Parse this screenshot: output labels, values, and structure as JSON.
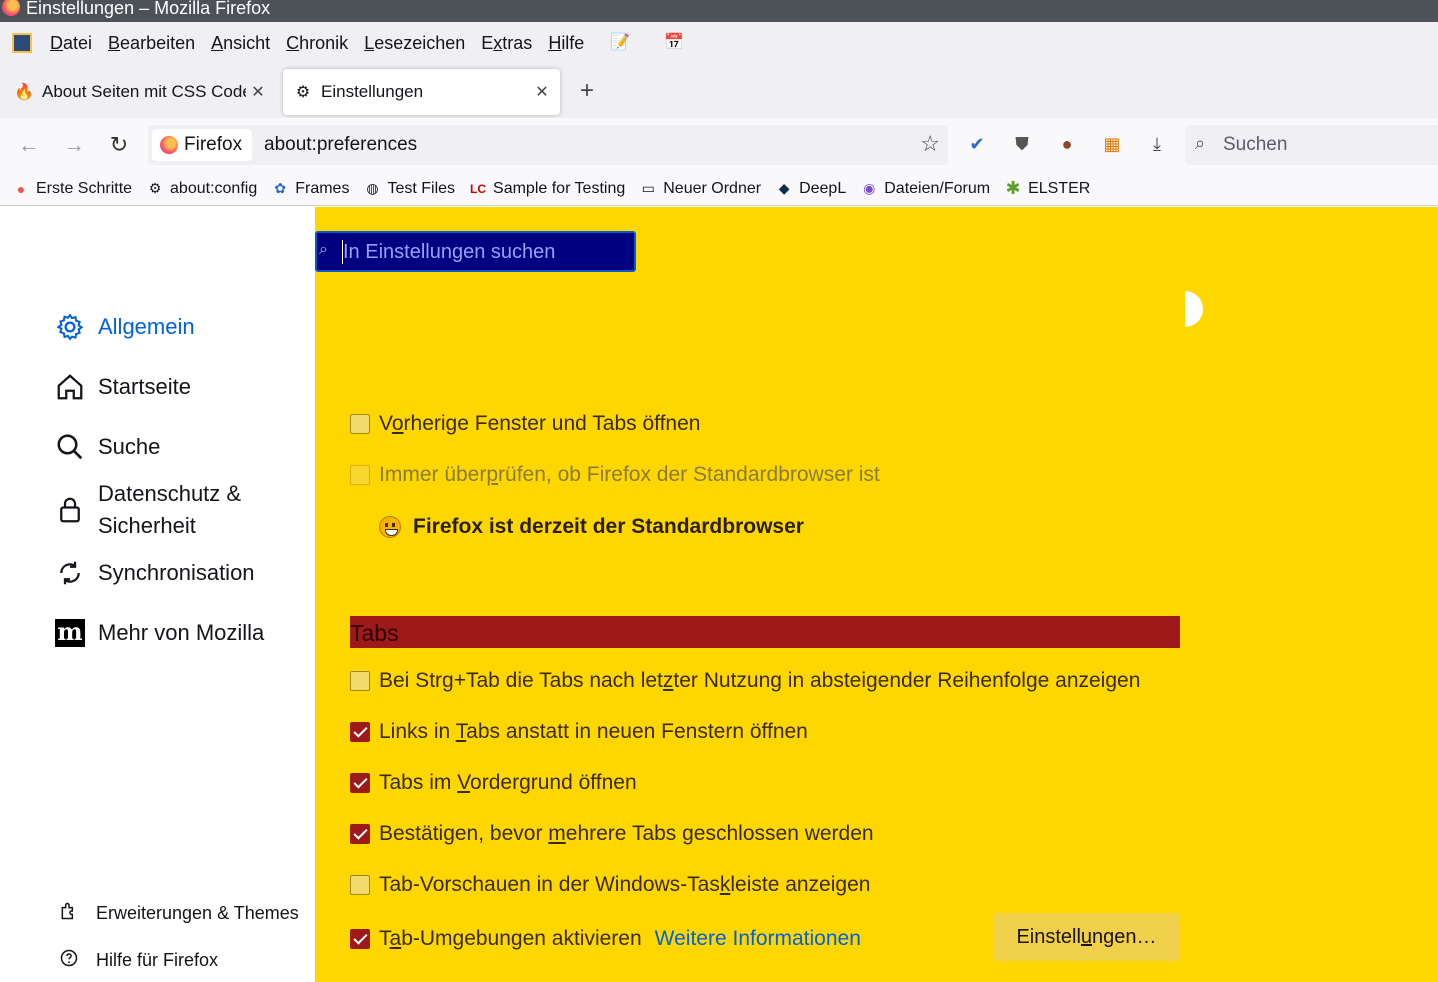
{
  "window": {
    "title": "Einstellungen – Mozilla Firefox"
  },
  "menubar": {
    "items": [
      "Datei",
      "Bearbeiten",
      "Ansicht",
      "Chronik",
      "Lesezeichen",
      "Extras",
      "Hilfe"
    ]
  },
  "tabs": [
    {
      "title": "About Seiten mit CSS Code ände",
      "icon": "flame-icon"
    },
    {
      "title": "Einstellungen",
      "icon": "gear-icon"
    }
  ],
  "navbar": {
    "identity_label": "Firefox",
    "url": "about:preferences",
    "search_placeholder": "Suchen"
  },
  "bookmarks": [
    {
      "label": "Erste Schritte",
      "icon": "firefox-icon"
    },
    {
      "label": "about:config",
      "icon": "gear-icon"
    },
    {
      "label": "Frames",
      "icon": "frames-icon"
    },
    {
      "label": "Test Files",
      "icon": "globe-icon"
    },
    {
      "label": "Sample for Testing",
      "icon": "lc-icon"
    },
    {
      "label": "Neuer Ordner",
      "icon": "folder-icon"
    },
    {
      "label": "DeepL",
      "icon": "deepl-icon"
    },
    {
      "label": "Dateien/Forum",
      "icon": "forum-icon"
    },
    {
      "label": "ELSTER",
      "icon": "star-icon"
    }
  ],
  "sidebar": {
    "categories": [
      {
        "label": "Allgemein",
        "icon": "gear-icon",
        "active": true
      },
      {
        "label": "Startseite",
        "icon": "home-icon"
      },
      {
        "label": "Suche",
        "icon": "search-icon"
      },
      {
        "label": "Datenschutz &",
        "label2": "Sicherheit",
        "icon": "lock-icon"
      },
      {
        "label": "Synchronisation",
        "icon": "sync-icon"
      },
      {
        "label": "Mehr von Mozilla",
        "icon": "mozilla-icon"
      }
    ],
    "footer": [
      {
        "label": "Erweiterungen & Themes",
        "icon": "puzzle-icon"
      },
      {
        "label": "Hilfe für Firefox",
        "icon": "help-icon"
      }
    ]
  },
  "main": {
    "search_placeholder": "In Einstellungen suchen",
    "startup": {
      "restore_session": {
        "label_pre": "V",
        "label_ul": "o",
        "label_post": "rherige Fenster und Tabs öffnen",
        "checked": false
      },
      "check_default": {
        "label_pre": "Immer über",
        "label_ul": "p",
        "label_post": "rüfen, ob Firefox der Standardbrowser ist",
        "checked": false,
        "disabled": true
      },
      "default_message": "Firefox ist derzeit der Standardbrowser"
    },
    "tabs_section": {
      "heading": "Tabs",
      "options": [
        {
          "pre": "Bei Strg+Tab die Tabs nach let",
          "ul": "z",
          "post": "ter Nutzung in absteigender Reihenfolge anzeigen",
          "checked": false
        },
        {
          "pre": "Links in ",
          "ul": "T",
          "post": "abs anstatt in neuen Fenstern öffnen",
          "checked": true
        },
        {
          "pre": "Tabs im ",
          "ul": "V",
          "post": "ordergrund öffnen",
          "checked": true
        },
        {
          "pre": "Bestätigen, bevor ",
          "ul": "m",
          "post": "ehrere Tabs geschlossen werden",
          "checked": true
        },
        {
          "pre": "Tab-Vorschauen in der Windows-Tas",
          "ul": "k",
          "post": "leiste anzeigen",
          "checked": false
        },
        {
          "pre": "T",
          "ul": "a",
          "post": "b-Umgebungen aktivieren",
          "checked": true
        }
      ],
      "more_info_link": "Weitere Informationen",
      "settings_button": {
        "pre": "Einstell",
        "ul": "u",
        "post": "ngen…"
      }
    }
  },
  "colors": {
    "page_background": "#ffd700",
    "section_header": "#9e1a1a",
    "checkbox_checked": "#9e1a1a",
    "search_box": "#000080",
    "accent": "#0061e0"
  }
}
